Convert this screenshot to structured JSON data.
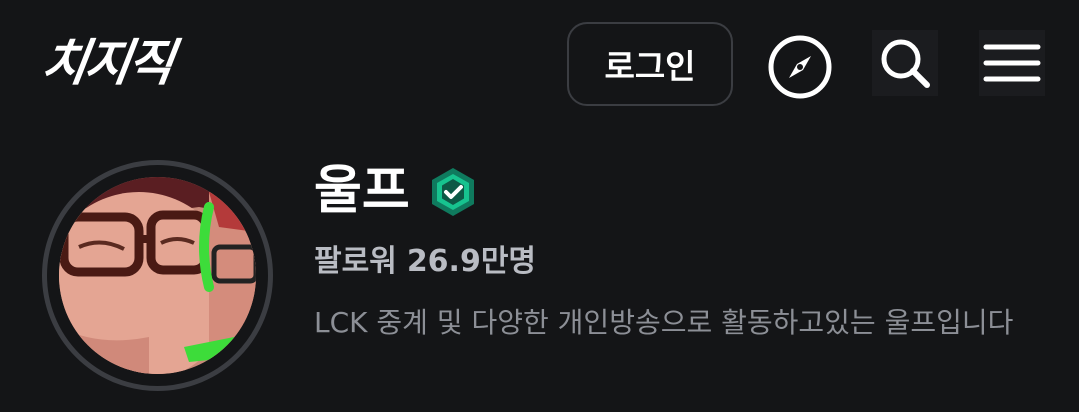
{
  "header": {
    "logo_text": "치지직",
    "login_label": "로그인",
    "icons": {
      "explore": "compass-icon",
      "search": "search-icon",
      "menu": "hamburger-menu-icon"
    }
  },
  "profile": {
    "name": "울프",
    "verified_icon": "verified-badge-icon",
    "followers_label": "팔로워",
    "followers_count": "26.9만명",
    "description": "LCK 중계 및 다양한 개인방송으로 활동하고있는 울프입니다"
  },
  "colors": {
    "background": "#141517",
    "verified": "#17c38f",
    "border": "#3b3d42"
  }
}
